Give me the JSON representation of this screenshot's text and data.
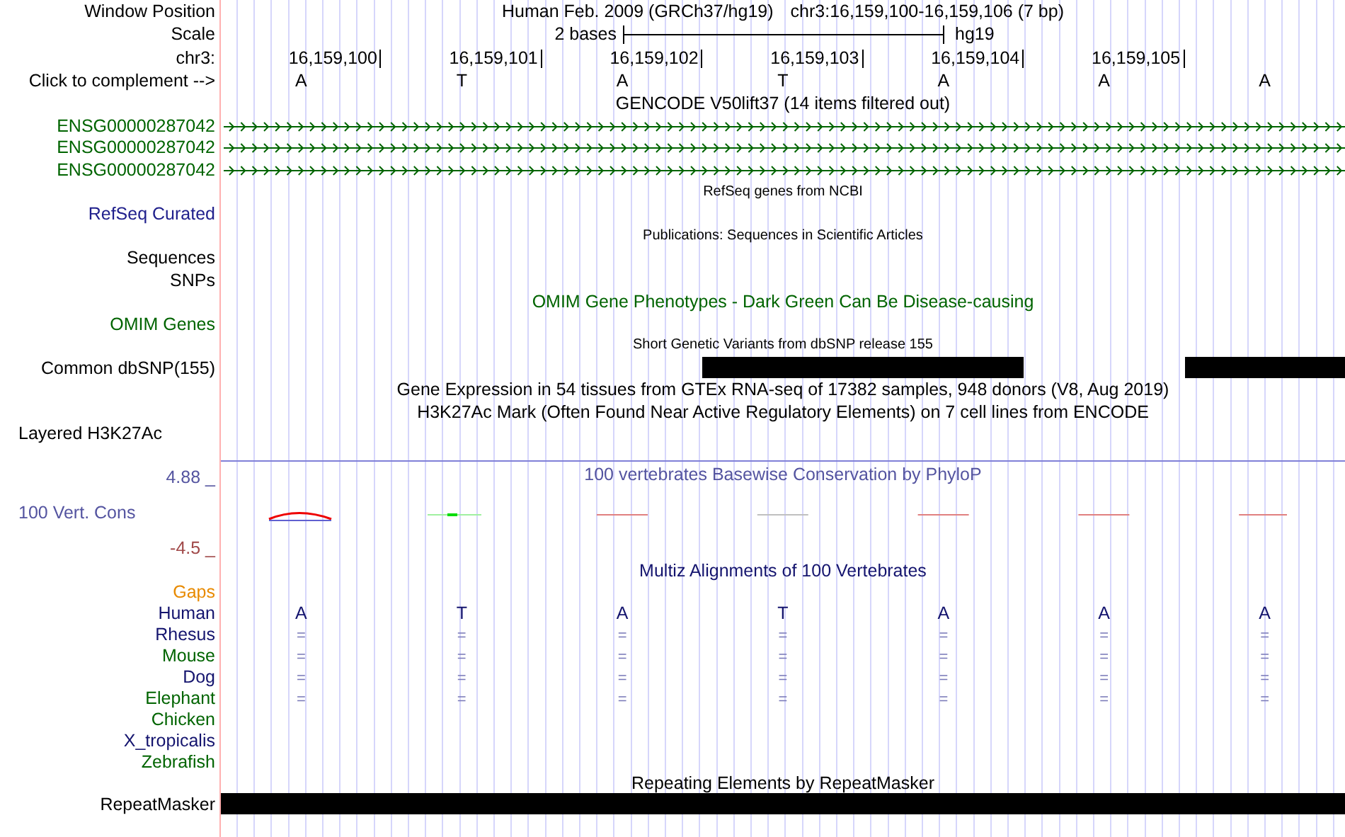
{
  "header": {
    "window_position": {
      "label": "Window Position",
      "assembly": "Human Feb. 2009 (GRCh37/hg19)",
      "position": "chr3:16,159,100-16,159,106 (7 bp)"
    },
    "scale": {
      "label": "Scale",
      "span": "2 bases",
      "assembly": "hg19"
    },
    "ruler": {
      "label": "chr3:",
      "ticks": [
        "16,159,100",
        "16,159,101",
        "16,159,102",
        "16,159,103",
        "16,159,104",
        "16,159,105"
      ]
    },
    "complement": {
      "label": "Click to complement -->",
      "bases": [
        "A",
        "T",
        "A",
        "T",
        "A",
        "A",
        "A"
      ]
    }
  },
  "tracks": [
    {
      "kind": "title",
      "text": "GENCODE V50lift37 (14 items filtered out)",
      "color": "#000000"
    },
    {
      "kind": "gene",
      "label": "ENSG00000287042",
      "color": "#006400"
    },
    {
      "kind": "gene",
      "label": "ENSG00000287042",
      "color": "#006400"
    },
    {
      "kind": "gene",
      "label": "ENSG00000287042",
      "color": "#006400"
    },
    {
      "kind": "caption",
      "text": "RefSeq genes from NCBI"
    },
    {
      "kind": "label",
      "label": "RefSeq Curated",
      "color": "#20208c"
    },
    {
      "kind": "caption",
      "text": "Publications: Sequences in Scientific Articles"
    },
    {
      "kind": "label",
      "label": "Sequences",
      "color": "#000000"
    },
    {
      "kind": "label",
      "label": "SNPs",
      "color": "#000000"
    },
    {
      "kind": "title",
      "text": "OMIM Gene Phenotypes - Dark Green Can Be Disease-causing",
      "color": "#006400"
    },
    {
      "kind": "label",
      "label": "OMIM Genes",
      "color": "#006400"
    },
    {
      "kind": "caption",
      "text": "Short Genetic Variants from dbSNP release 155"
    },
    {
      "kind": "bars",
      "label": "Common dbSNP(155)",
      "color": "#000000",
      "cells": [
        {
          "covered": false
        },
        {
          "covered": false
        },
        {
          "covered": false
        },
        {
          "covered": true
        },
        {
          "covered": true
        },
        {
          "covered": false
        },
        {
          "covered": true
        }
      ]
    },
    {
      "kind": "title",
      "text": "Gene Expression in 54 tissues from GTEx RNA-seq of 17382 samples, 948 donors (V8, Aug 2019)",
      "color": "#000000"
    },
    {
      "kind": "title",
      "text": "H3K27Ac Mark (Often Found Near Active Regulatory Elements) on 7 cell lines from ENCODE",
      "color": "#000000"
    },
    {
      "kind": "left_label",
      "label": "Layered H3K27Ac",
      "color": "#000000"
    },
    {
      "kind": "conservation",
      "title": "100 vertebrates Basewise Conservation by PhyloP",
      "label": "100 Vert. Cons",
      "max": "4.88 _",
      "min": "-4.5 _"
    },
    {
      "kind": "title",
      "text": "Multiz Alignments of 100 Vertebrates",
      "color": "#14146e"
    },
    {
      "kind": "label",
      "label": "Gaps",
      "color": "#e88a00"
    },
    {
      "kind": "alignment",
      "label": "Human",
      "color": "#14146e",
      "bases": [
        "A",
        "T",
        "A",
        "T",
        "A",
        "A",
        "A"
      ]
    },
    {
      "kind": "match",
      "label": "Rhesus",
      "color": "#14146e",
      "bases": [
        "=",
        "=",
        "=",
        "=",
        "=",
        "=",
        "="
      ]
    },
    {
      "kind": "match",
      "label": "Mouse",
      "color": "#006400",
      "bases": [
        "=",
        "=",
        "=",
        "=",
        "=",
        "=",
        "="
      ]
    },
    {
      "kind": "match",
      "label": "Dog",
      "color": "#14146e",
      "bases": [
        "=",
        "=",
        "=",
        "=",
        "=",
        "=",
        "="
      ]
    },
    {
      "kind": "match",
      "label": "Elephant",
      "color": "#006400",
      "bases": [
        "=",
        "=",
        "=",
        "=",
        "=",
        "=",
        "="
      ]
    },
    {
      "kind": "label",
      "label": "Chicken",
      "color": "#006400"
    },
    {
      "kind": "label",
      "label": "X_tropicalis",
      "color": "#14146e"
    },
    {
      "kind": "label",
      "label": "Zebrafish",
      "color": "#006400"
    },
    {
      "kind": "title",
      "text": "Repeating Elements by RepeatMasker",
      "color": "#000000"
    },
    {
      "kind": "span_bar",
      "label": "RepeatMasker",
      "color": "#000000"
    }
  ]
}
